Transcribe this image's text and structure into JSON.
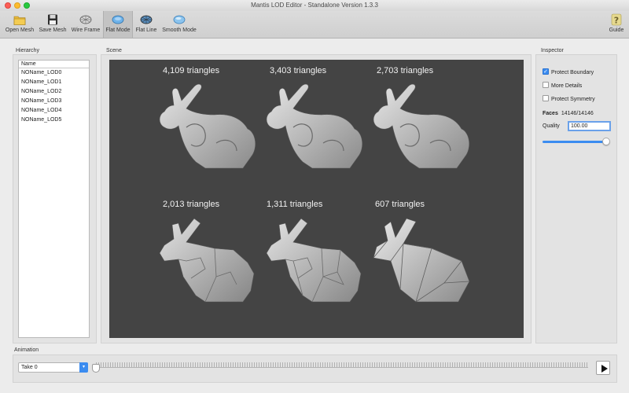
{
  "window": {
    "title": "Mantis LOD Editor - Standalone Version 1.3.3"
  },
  "toolbar": {
    "open_mesh": "Open Mesh",
    "save_mesh": "Save Mesh",
    "wire_frame": "Wire Frame",
    "flat_mode": "Flat Mode",
    "flat_line": "Flat Line",
    "smooth_mode": "Smooth Mode",
    "guide": "Guide",
    "active_mode": "Flat Mode"
  },
  "hierarchy": {
    "title": "Hierarchy",
    "header": "Name",
    "items": [
      "NOName_LOD0",
      "NOName_LOD1",
      "NOName_LOD2",
      "NOName_LOD3",
      "NOName_LOD4",
      "NOName_LOD5"
    ]
  },
  "scene": {
    "title": "Scene",
    "labels": [
      "4,109 triangles",
      "3,403 triangles",
      "2,703 triangles",
      "2,013 triangles",
      "1,311 triangles",
      "607 triangles"
    ]
  },
  "inspector": {
    "title": "Inspector",
    "protect_boundary": "Protect Boundary",
    "protect_boundary_checked": true,
    "more_details": "More Details",
    "more_details_checked": false,
    "protect_symmetry": "Protect Symmetry",
    "protect_symmetry_checked": false,
    "faces_label": "Faces",
    "faces_value": "14146/14146",
    "quality_label": "Quality",
    "quality_value": "100.00",
    "quality_slider_fraction": 1.0
  },
  "animation": {
    "title": "Animation",
    "take": "Take 0",
    "timeline_position": 0
  },
  "colors": {
    "accent": "#3b8cf0",
    "scene_bg": "#444444",
    "mesh": "#bdbdbd"
  }
}
